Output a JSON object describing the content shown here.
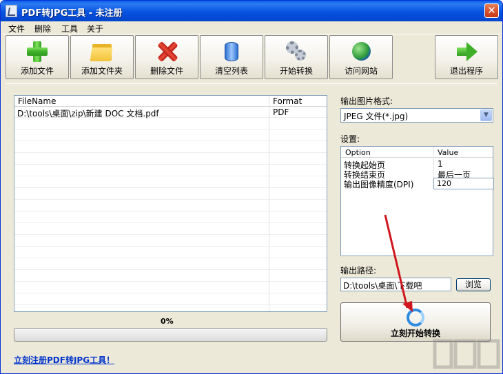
{
  "window": {
    "title": "PDF转JPG工具 - 未注册",
    "close_glyph": "✕"
  },
  "menu": [
    "文件",
    "删除",
    "工具",
    "关于"
  ],
  "toolbar": {
    "add_file": "添加文件",
    "add_folder": "添加文件夹",
    "delete_file": "删除文件",
    "clear_list": "清空列表",
    "start_convert": "开始转换",
    "visit_site": "访问网站",
    "exit": "退出程序"
  },
  "file_list": {
    "columns": [
      "FileName",
      "Format"
    ],
    "rows": [
      {
        "name": "D:\\tools\\桌面\\zip\\新建 DOC 文档.pdf",
        "format": "PDF"
      }
    ]
  },
  "progress": {
    "percent_label": "0%",
    "value": 0
  },
  "register_link": "立刻注册PDF转JPG工具！",
  "output_format": {
    "label": "输出图片格式:",
    "selected": "JPEG 文件(*.jpg)"
  },
  "settings": {
    "label": "设置:",
    "columns": [
      "Option",
      "Value"
    ],
    "rows": [
      {
        "option": "转换起始页",
        "value": "1"
      },
      {
        "option": "转换结束页",
        "value": "最后一页"
      },
      {
        "option": "输出图像精度(DPI)",
        "value": "120"
      }
    ]
  },
  "output_path": {
    "label": "输出路径:",
    "value": "D:\\tools\\桌面\\下载吧",
    "browse_label": "浏览"
  },
  "start_now_label": "立刻开始转换",
  "icons": {
    "add_file": "green-plus-icon",
    "add_folder": "folder-icon",
    "delete_file": "red-x-icon",
    "clear_list": "database-can-icon",
    "start_convert": "gears-icon",
    "visit_site": "globe-icon",
    "exit": "green-arrow-icon",
    "start_now": "refresh-icon"
  },
  "colors": {
    "title_bar": "#0653E0",
    "link": "#0033cc",
    "annotation_arrow": "#D0161E"
  }
}
